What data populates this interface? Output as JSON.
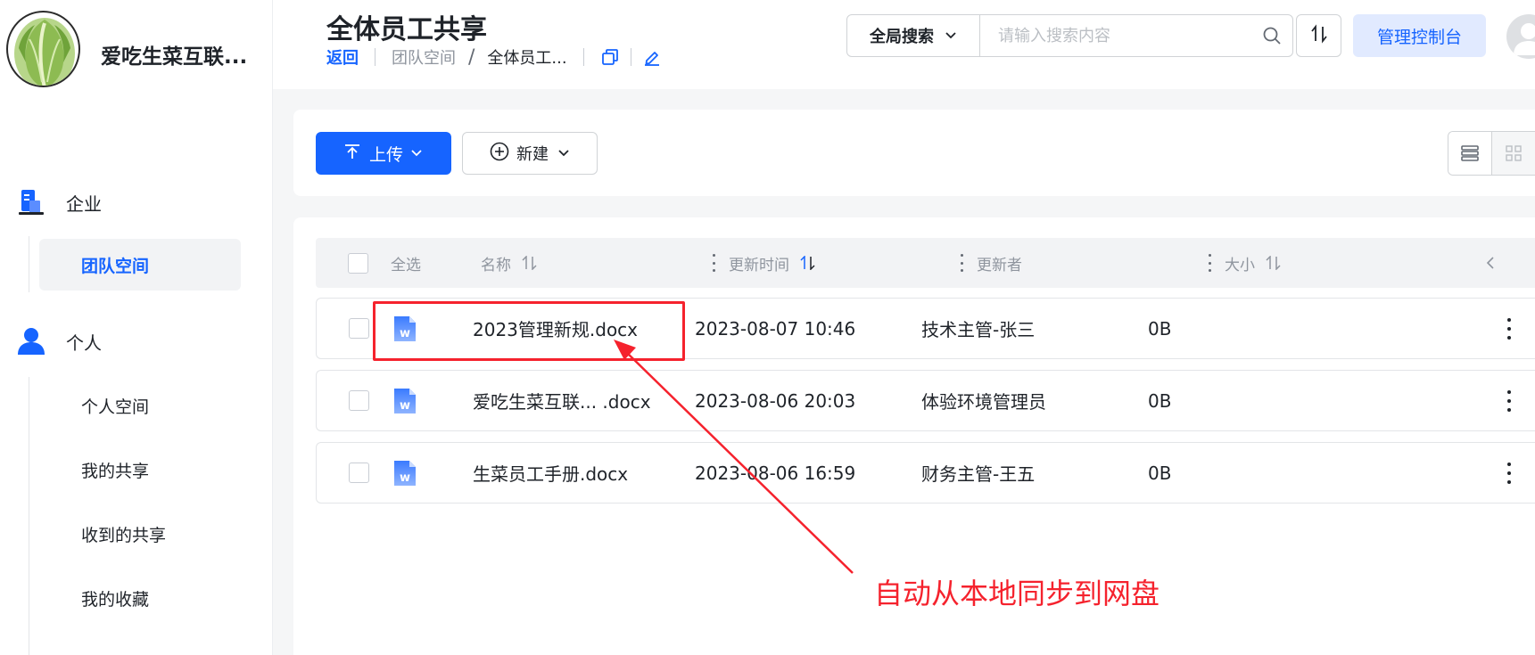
{
  "brand": {
    "name": "爱吃生菜互联...",
    "logo": "lettuce-logo"
  },
  "sidebar": {
    "groups": [
      {
        "label": "企业",
        "icon": "building-icon",
        "items": [
          {
            "label": "团队空间",
            "active": true
          }
        ]
      },
      {
        "label": "个人",
        "icon": "person-icon",
        "items": [
          {
            "label": "个人空间"
          },
          {
            "label": "我的共享"
          },
          {
            "label": "收到的共享"
          },
          {
            "label": "我的收藏"
          }
        ]
      }
    ]
  },
  "header": {
    "title": "全体员工共享",
    "breadcrumb": {
      "back": "返回",
      "parent": "团队空间",
      "separator": "/",
      "current": "全体员工..."
    },
    "search": {
      "scope": "全局搜索",
      "placeholder": "请输入搜索内容"
    },
    "admin_button": "管理控制台"
  },
  "toolbar": {
    "upload_label": "上传",
    "new_label": "新建"
  },
  "table": {
    "columns": {
      "select_all": "全选",
      "name": "名称",
      "updated_time": "更新时间",
      "updater": "更新者",
      "size": "大小"
    },
    "rows": [
      {
        "name": "2023管理新规.docx",
        "updated_time": "2023-08-07 10:46",
        "updater": "技术主管-张三",
        "size": "0B"
      },
      {
        "name": "爱吃生菜互联... .docx",
        "updated_time": "2023-08-06 20:03",
        "updater": "体验环境管理员",
        "size": "0B"
      },
      {
        "name": "生菜员工手册.docx",
        "updated_time": "2023-08-06 16:59",
        "updater": "财务主管-王五",
        "size": "0B"
      }
    ]
  },
  "annotation": {
    "text": "自动从本地同步到网盘",
    "color": "#f5222d"
  },
  "colors": {
    "accent": "#1664ff",
    "admin_bg": "#e1eaff",
    "annotation": "#f5222d"
  }
}
